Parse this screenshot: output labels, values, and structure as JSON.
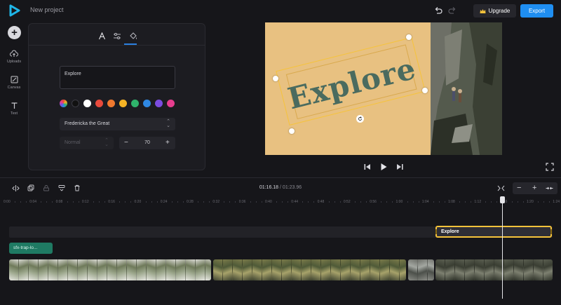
{
  "header": {
    "project_name": "New project",
    "upgrade_label": "Upgrade",
    "export_label": "Export"
  },
  "sidebar": {
    "items": [
      {
        "label": "Uploads",
        "icon": "upload-cloud-icon"
      },
      {
        "label": "Canvas",
        "icon": "canvas-icon"
      },
      {
        "label": "Text",
        "icon": "text-icon"
      }
    ]
  },
  "text_panel": {
    "tabs": [
      {
        "icon": "letter-a-icon",
        "active": true
      },
      {
        "icon": "sliders-icon"
      },
      {
        "icon": "paint-bucket-icon"
      }
    ],
    "text_value": "Explore",
    "colors": [
      "rainbow",
      "#111111",
      "#ffffff",
      "#e84a3c",
      "#f0792f",
      "#f5b325",
      "#2fb36b",
      "#2f88e3",
      "#7b4ce0",
      "#e63e8f"
    ],
    "font_name": "Fredericka the Great",
    "font_weight": "Normal",
    "font_size": "70"
  },
  "canvas": {
    "overlay_text": "Explore",
    "text_color": "#4a6b5f",
    "background_color": "#e8c181"
  },
  "timeline": {
    "current_time": "01:16.18",
    "separator": " / ",
    "total_time": "01:23.96",
    "ruler_ticks": [
      "0:00",
      "0:04",
      "0:08",
      "0:12",
      "0:16",
      "0:20",
      "0:24",
      "0:28",
      "0:32",
      "0:36",
      "0:40",
      "0:44",
      "0:48",
      "0:52",
      "0:56",
      "1:00",
      "1:04",
      "1:08",
      "1:12",
      "1:16",
      "1:20",
      "1:24"
    ],
    "text_clip_label": "Explore",
    "audio_clip_label": "sfx-trap-lo...",
    "zoom_controls": [
      "−",
      "+"
    ]
  }
}
